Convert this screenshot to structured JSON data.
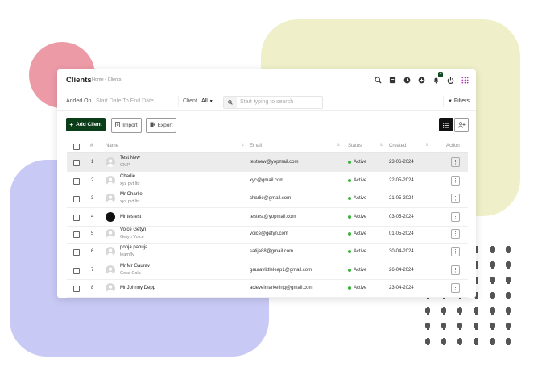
{
  "header": {
    "title": "Clients",
    "breadcrumb": "Home • Clients",
    "notification_count": "4"
  },
  "filters": {
    "added_on_label": "Added On",
    "date_placeholder": "Start Date To End Date",
    "client_label": "Client",
    "client_value": "All",
    "search_placeholder": "Start typing to search",
    "filters_label": "Filters"
  },
  "toolbar": {
    "add_label": "Add Client",
    "import_label": "Import",
    "export_label": "Export"
  },
  "table": {
    "columns": {
      "num": "#",
      "name": "Name",
      "email": "Email",
      "status": "Status",
      "created": "Created",
      "action": "Action"
    },
    "rows": [
      {
        "num": "1",
        "name": "Test New",
        "company": "CMP",
        "email": "testnew@yopmail.com",
        "status": "Active",
        "created": "23-06-2024"
      },
      {
        "num": "2",
        "name": "Charlie",
        "company": "xyz pvt ltd",
        "email": "xyc@gmail.com",
        "status": "Active",
        "created": "22-05-2024"
      },
      {
        "num": "3",
        "name": "Mr Charlie",
        "company": "xyz pvt ltd",
        "email": "charlie@gmail.com",
        "status": "Active",
        "created": "21-05-2024"
      },
      {
        "num": "4",
        "name": "Mr testest",
        "company": "",
        "email": "testest@yopmail.com",
        "status": "Active",
        "created": "03-05-2024"
      },
      {
        "num": "5",
        "name": "Voice Getyn",
        "company": "Getyn Voice",
        "email": "voice@getyn.com",
        "status": "Active",
        "created": "01-05-2024"
      },
      {
        "num": "6",
        "name": "pooja pahuja",
        "company": "learnfly",
        "email": "satija88@gmail.com",
        "status": "Active",
        "created": "30-04-2024"
      },
      {
        "num": "7",
        "name": "Mr Mr Gaurav",
        "company": "Coca Cola",
        "email": "gauravlittleleap1@gmail.com",
        "status": "Active",
        "created": "26-04-2024"
      },
      {
        "num": "8",
        "name": "Mr Johnny Depp",
        "company": "",
        "email": "aclevelmarketing@gmail.com",
        "status": "Active",
        "created": "23-04-2024"
      }
    ]
  },
  "colors": {
    "brand": "#0b3d18",
    "active": "#3bb53b",
    "pink": "#ec9aa6",
    "yellow": "#eff0c9",
    "purple": "#c8c9f4"
  }
}
